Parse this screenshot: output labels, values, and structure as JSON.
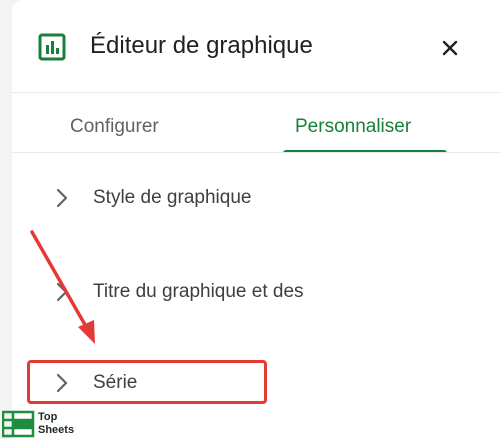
{
  "header": {
    "title": "Éditeur de graphique",
    "chart_icon": "bar-chart-icon",
    "close_icon": "close-icon"
  },
  "tabs": [
    {
      "label": "Configurer",
      "active": false
    },
    {
      "label": "Personnaliser",
      "active": true
    }
  ],
  "sections": [
    {
      "label": "Style de graphique",
      "icon": "chevron-right-icon"
    },
    {
      "label": "Titre du graphique et des",
      "icon": "chevron-right-icon"
    },
    {
      "label": "Série",
      "icon": "chevron-right-icon",
      "highlighted": true
    }
  ],
  "annotation": {
    "arrow_color": "#e53935",
    "box_color": "#e53935"
  },
  "watermark": {
    "line1": "Top",
    "line2": "Sheets"
  },
  "colors": {
    "accent": "#188038",
    "text_primary": "#202124",
    "text_secondary": "#5f6368"
  }
}
